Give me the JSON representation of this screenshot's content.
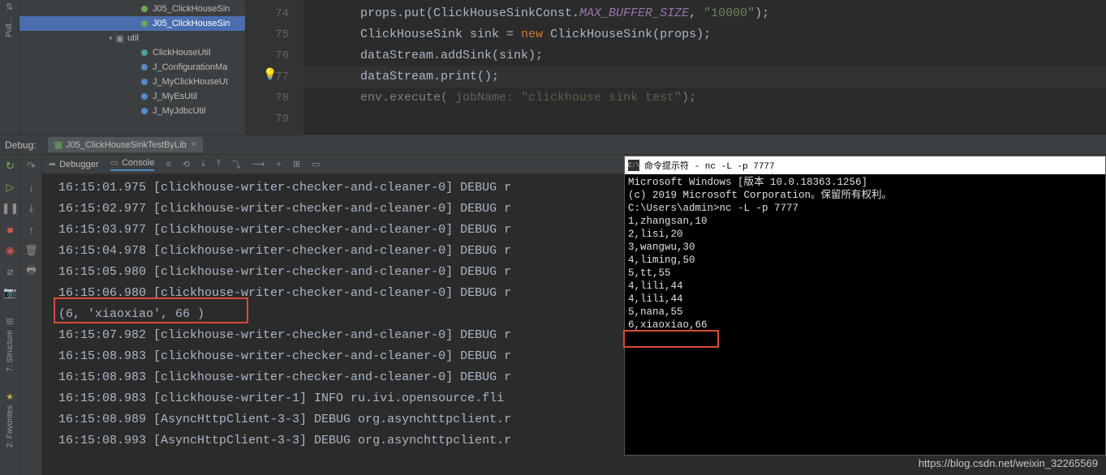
{
  "sidebar_vertical": "Pull...",
  "tree": {
    "file1": "J05_ClickHouseSin",
    "file2": "J05_ClickHouseSin",
    "folder": "util",
    "util_items": [
      "ClickHouseUtil",
      "J_ConfigurationMa",
      "J_MyClickHouseUt",
      "J_MyEsUtil",
      "J_MyJdbcUtil"
    ]
  },
  "line_numbers": [
    "74",
    "75",
    "76",
    "77",
    "78",
    "79"
  ],
  "code": {
    "l1a": "props.put(ClickHouseSinkConst.",
    "l1b": "MAX_BUFFER_SIZE",
    "l1c": ", ",
    "l1d": "\"10000\"",
    "l1e": ");",
    "l2a": "ClickHouseSink sink = ",
    "l2b": "new",
    "l2c": " ClickHouseSink(props);",
    "l3": "dataStream.addSink(sink);",
    "l4": "dataStream.print();",
    "l5": "",
    "l6a": "env.execute( ",
    "l6b": "jobName: ",
    "l6c": "\"clickhouse sink test\"",
    "l6d": ");"
  },
  "debug": {
    "label": "Debug:",
    "tab": "J05_ClickHouseSinkTestByLib",
    "debugger_tab": "Debugger",
    "console_tab": "Console"
  },
  "console_lines": [
    "16:15:01.975 [clickhouse-writer-checker-and-cleaner-0] DEBUG r",
    "16:15:02.977 [clickhouse-writer-checker-and-cleaner-0] DEBUG r",
    "16:15:03.977 [clickhouse-writer-checker-and-cleaner-0] DEBUG r",
    "16:15:04.978 [clickhouse-writer-checker-and-cleaner-0] DEBUG r",
    "16:15:05.980 [clickhouse-writer-checker-and-cleaner-0] DEBUG r",
    "16:15:06.980 [clickhouse-writer-checker-and-cleaner-0] DEBUG r",
    "(6, 'xiaoxiao', 66 )",
    "16:15:07.982 [clickhouse-writer-checker-and-cleaner-0] DEBUG r",
    "16:15:08.983 [clickhouse-writer-checker-and-cleaner-0] DEBUG r",
    "16:15:08.983 [clickhouse-writer-checker-and-cleaner-0] DEBUG r",
    "16:15:08.983 [clickhouse-writer-1] INFO ru.ivi.opensource.fli",
    "16:15:08.989 [AsyncHttpClient-3-3] DEBUG org.asynchttpclient.r",
    "16:15:08.993 [AsyncHttpClient-3-3] DEBUG org.asynchttpclient.r"
  ],
  "cmd": {
    "title": "命令提示符 - nc  -L -p 7777",
    "lines": [
      "Microsoft Windows [版本 10.0.18363.1256]",
      "(c) 2019 Microsoft Corporation。保留所有权利。",
      "",
      "C:\\Users\\admin>nc -L -p 7777",
      "1,zhangsan,10",
      "2,lisi,20",
      "3,wangwu,30",
      "4,liming,50",
      "",
      "5,tt,55",
      "4,lili,44",
      "4,lili,44",
      "5,nana,55",
      "6,xiaoxiao,66"
    ]
  },
  "left_labels": {
    "structure": "7: Structure",
    "favorites": "2: Favorites"
  },
  "watermark": "https://blog.csdn.net/weixin_32265569"
}
